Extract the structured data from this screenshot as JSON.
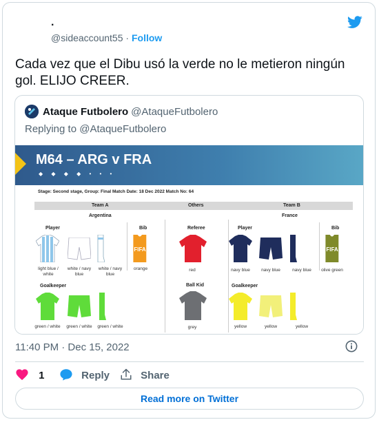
{
  "tweet": {
    "display_name": ".",
    "handle": "@sideaccount55",
    "separator": "·",
    "follow_label": "Follow",
    "text": "Cada vez que el Dibu usó la verde no le metieron ningún gol. ELIJO CREER.",
    "timestamp": "11:40 PM · Dec 15, 2022",
    "likes_count": "1",
    "reply_label": "Reply",
    "share_label": "Share",
    "read_more_label": "Read more on Twitter",
    "icons": [
      "twitter-bird-icon",
      "info-icon",
      "heart-icon",
      "reply-bubble-icon",
      "share-icon"
    ],
    "colors": {
      "accent": "#1d9bf0",
      "like": "#f91880",
      "link": "#006fd6"
    }
  },
  "quote": {
    "name": "Ataque Futbolero",
    "handle": "@AtaqueFutbolero",
    "replying_to": "Replying to @AtaqueFutbolero"
  },
  "kit_image": {
    "title": "M64 – ARG v FRA",
    "dots": "◆ ◆ ◆ ◆ • • •",
    "stage_line": "Stage: Second stage,   Group: Final   Match Date: 18 Dec 2022   Match No: 64",
    "headers": {
      "team_a": "Team A",
      "others": "Others",
      "team_b": "Team B"
    },
    "team_a_name": "Argentina",
    "team_b_name": "France",
    "sections": {
      "player_a": "Player",
      "bib_a": "Bib",
      "goalkeeper_a": "Goalkeeper",
      "referee": "Referee",
      "ball_kid": "Ball Kid",
      "player_b": "Player",
      "bib_b": "Bib",
      "goalkeeper_b": "Goalkeeper"
    },
    "captions": {
      "a_shirt": "light blue / white",
      "a_shorts": "white / navy blue",
      "a_socks": "white / navy blue",
      "a_bib": "orange",
      "a_gk_shirt": "green / white",
      "a_gk_shorts": "green / white",
      "a_gk_socks": "green / white",
      "ref": "red",
      "ball_kid": "grey",
      "b_shirt": "navy blue",
      "b_shorts": "navy blue",
      "b_socks": "navy blue",
      "b_bib": "olive green",
      "b_gk_shirt": "yellow",
      "b_gk_shorts": "yellow",
      "b_gk_socks": "yellow"
    },
    "bib_text": "FIFA"
  }
}
